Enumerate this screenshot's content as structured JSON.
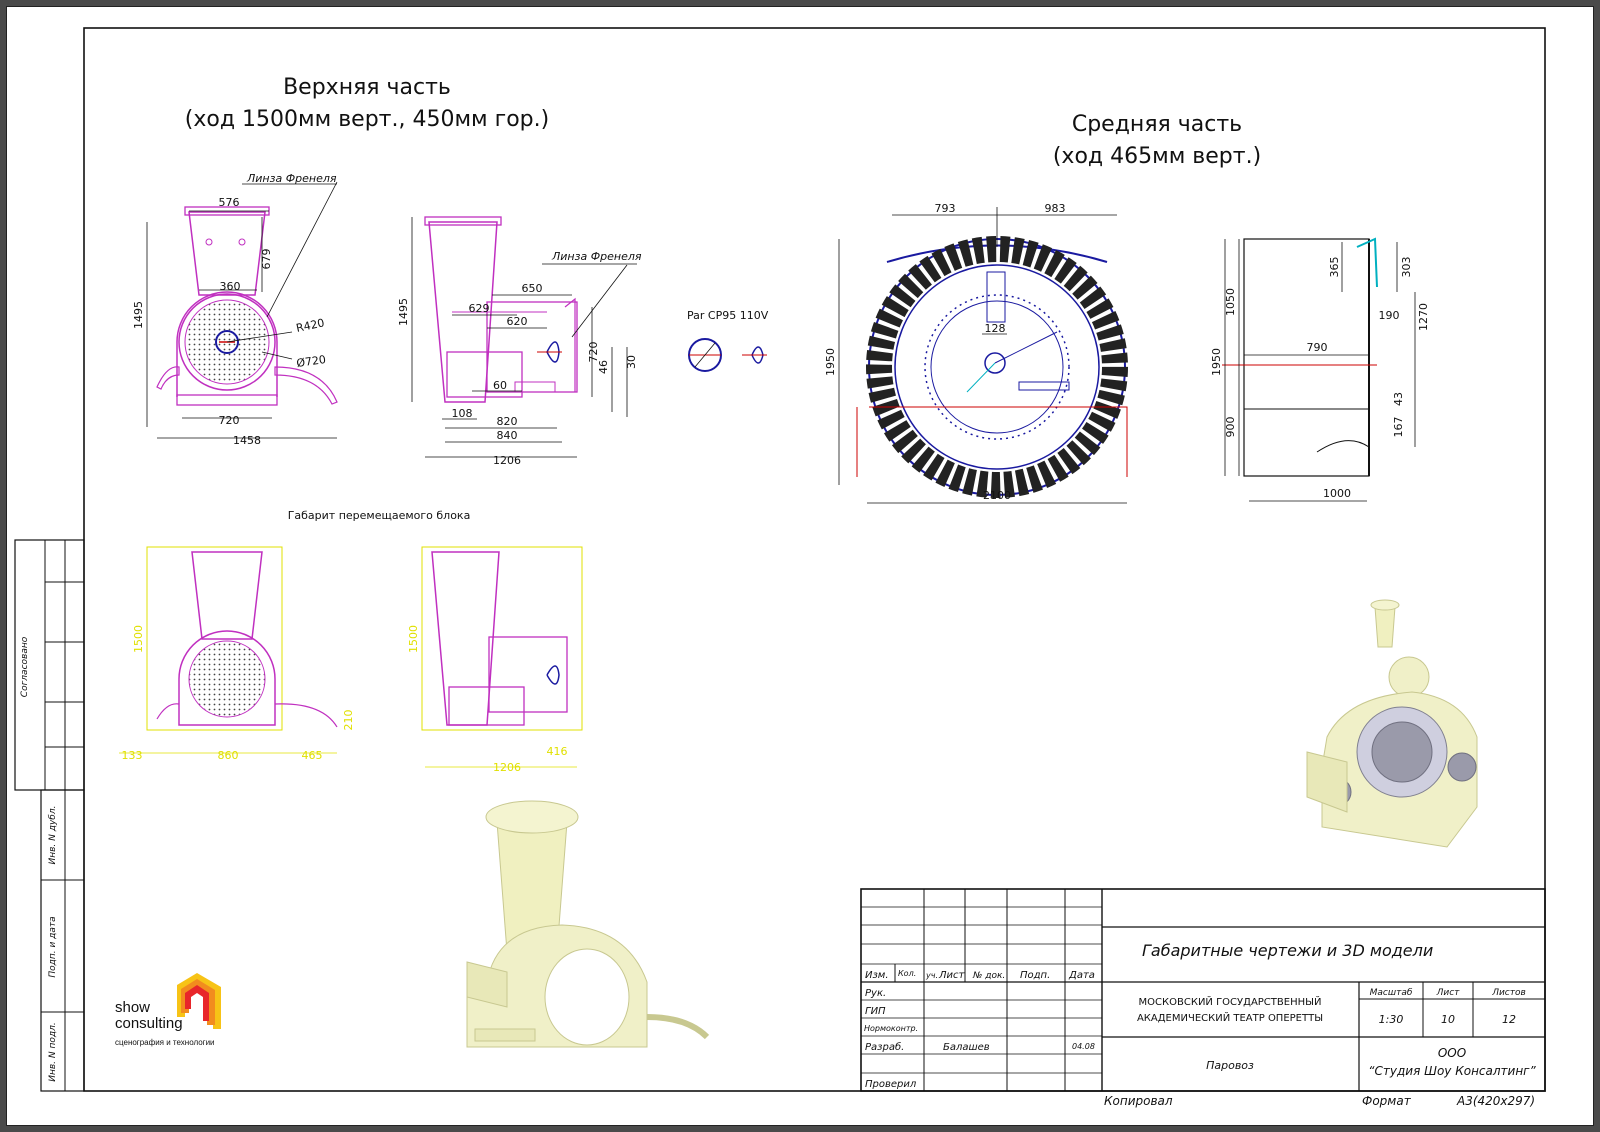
{
  "views": {
    "upper_title_1": "Верхняя часть",
    "upper_title_2": "(ход 1500мм верт., 450мм гор.)",
    "middle_title_1": "Средняя часть",
    "middle_title_2": "(ход 465мм верт.)",
    "fresnel_1": "Линза Френеля",
    "fresnel_2": "Линза Френеля",
    "par_label": "Par CP95 110V",
    "gabarit_label": "Габарит перемещаемого блока"
  },
  "dims_upper_front": {
    "d576": "576",
    "d679": "679",
    "d1495": "1495",
    "d360": "360",
    "r420": "R420",
    "d720c": "Ø720",
    "d720": "720",
    "d1458": "1458"
  },
  "dims_upper_side": {
    "d1495": "1495",
    "d650": "650",
    "d629": "629",
    "d620": "620",
    "d720": "720",
    "d46": "46",
    "d30": "30",
    "d60": "60",
    "d108": "108",
    "d820": "820",
    "d840": "840",
    "d1206": "1206"
  },
  "dims_middle_front": {
    "d793": "793",
    "d983": "983",
    "d1950": "1950",
    "d128": "128",
    "d2100": "2100"
  },
  "dims_middle_side": {
    "d365": "365",
    "d303": "303",
    "d1050": "1050",
    "d190": "190",
    "d1270": "1270",
    "d790": "790",
    "d1950": "1950",
    "d900": "900",
    "d43": "43",
    "d167": "167",
    "d1000": "1000"
  },
  "dims_gabarit": {
    "d1500a": "1500",
    "d210": "210",
    "d133": "133",
    "d860": "860",
    "d465": "465",
    "d1500b": "1500",
    "d416": "416",
    "d1206": "1206"
  },
  "side_stamp": {
    "agreed": "Согласовано",
    "inv_dubl": "Инв. N дубл.",
    "podp_data": "Подп. и дата",
    "inv_podl": "Инв. N подл."
  },
  "logo": {
    "line1": "show",
    "line2": "consulting",
    "tagline": "сценография и технологии",
    "colors": [
      "#e8262a",
      "#f28c1e",
      "#f7c316"
    ]
  },
  "title_block": {
    "doc_title": "Габаритные чертежи и 3D модели",
    "h_izm": "Изм.",
    "h_kol": "Кол.",
    "h_uch": "уч.",
    "h_list": "Лист",
    "h_ndok": "№ док.",
    "h_podp": "Подп.",
    "h_data": "Дата",
    "r_ruk": "Рук.",
    "r_gip": "ГИП",
    "r_norm": "Нормоконтр.",
    "r_razrab": "Разраб.",
    "r_prov": "Проверил",
    "razrab_name": "Балашев",
    "razrab_date": "04.08",
    "org_1": "МОСКОВСКИЙ ГОСУДАРСТВЕННЫЙ",
    "org_2": "АКАДЕМИЧЕСКИЙ ТЕАТР ОПЕРЕТТЫ",
    "object": "Паровоз",
    "h_scale": "Масштаб",
    "h_sheet": "Лист",
    "h_sheets": "Листов",
    "scale": "1:30",
    "sheet": "10",
    "sheets": "12",
    "company_1": "ООО",
    "company_2": "“Студия Шоу Консалтинг”",
    "copied": "Копировал",
    "format_label": "Формат",
    "format_value": "А3(420x297)"
  }
}
